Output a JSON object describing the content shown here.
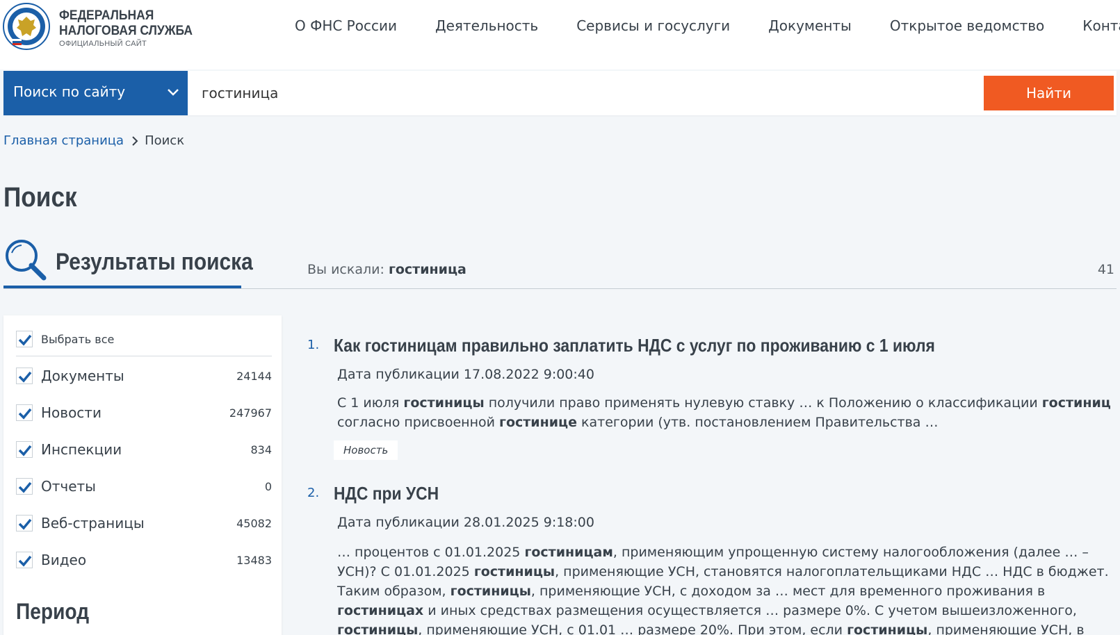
{
  "header": {
    "logo_line1": "ФЕДЕРАЛЬНАЯ",
    "logo_line2": "НАЛОГОВАЯ СЛУЖБА",
    "logo_line3": "ОФИЦИАЛЬНЫЙ САЙТ",
    "nav": [
      "О ФНС России",
      "Деятельность",
      "Сервисы и госуслуги",
      "Документы",
      "Открытое ведомство",
      "Контакты"
    ]
  },
  "search": {
    "scope_label": "Поиск по сайту",
    "query": "гостиница",
    "button_label": "Найти"
  },
  "breadcrumb": {
    "home": "Главная страница",
    "current": "Поиск"
  },
  "page_title": "Поиск",
  "results_header": {
    "heading": "Результаты поиска",
    "query_prefix": "Вы искали:",
    "query_value": "гостиница",
    "total": "41"
  },
  "filters": {
    "select_all": "Выбрать все",
    "items": [
      {
        "label": "Документы",
        "count": "24144",
        "checked": true
      },
      {
        "label": "Новости",
        "count": "247967",
        "checked": true
      },
      {
        "label": "Инспекции",
        "count": "834",
        "checked": true
      },
      {
        "label": "Отчеты",
        "count": "0",
        "checked": true
      },
      {
        "label": "Веб-страницы",
        "count": "45082",
        "checked": true
      },
      {
        "label": "Видео",
        "count": "13483",
        "checked": true
      }
    ],
    "period_heading": "Период"
  },
  "results": [
    {
      "num": "1.",
      "title": "Как гостиницам правильно заплатить НДС с услуг по проживанию с 1 июля",
      "date": "Дата публикации 17.08.2022 9:00:40",
      "snippet": [
        {
          "t": "С 1 июля "
        },
        {
          "b": "гостиницы"
        },
        {
          "t": " получили право применять нулевую ставку … к Положению о классификации "
        },
        {
          "b": "гостиниц"
        },
        {
          "t": " согласно присвоенной "
        },
        {
          "b": "гостинице"
        },
        {
          "t": " категории (утв. постановлением Правительства …"
        }
      ],
      "tag": "Новость"
    },
    {
      "num": "2.",
      "title": "НДС при УСН",
      "date": "Дата публикации 28.01.2025 9:18:00",
      "snippet": [
        {
          "t": "… процентов с 01.01.2025 "
        },
        {
          "b": "гостиницам"
        },
        {
          "t": ", применяющим упрощенную систему налогообложения (далее … – УСН)? С 01.01.2025 "
        },
        {
          "b": "гостиницы"
        },
        {
          "t": ", применяющие УСН, становятся налогоплательщиками НДС … НДС в бюджет. Таким образом, "
        },
        {
          "b": "гостиницы"
        },
        {
          "t": ", применяющие УСН, с доходом за … мест для временного проживания в "
        },
        {
          "b": "гостиницах"
        },
        {
          "t": " и иных средствах размещения осуществляется … размере 0%. С учетом вышеизложенного, "
        },
        {
          "b": "гостиницы"
        },
        {
          "t": ", применяющие УСН, с 01.01 … размере 20%. При этом, если "
        },
        {
          "b": "гостиницы"
        },
        {
          "t": ", применяющие УСН, в налоговой декларации …"
        }
      ]
    }
  ],
  "colors": {
    "brand_blue": "#1b5fa8",
    "accent_orange": "#f05a22",
    "text_dark": "#38414a",
    "background": "#f3f6f9"
  }
}
